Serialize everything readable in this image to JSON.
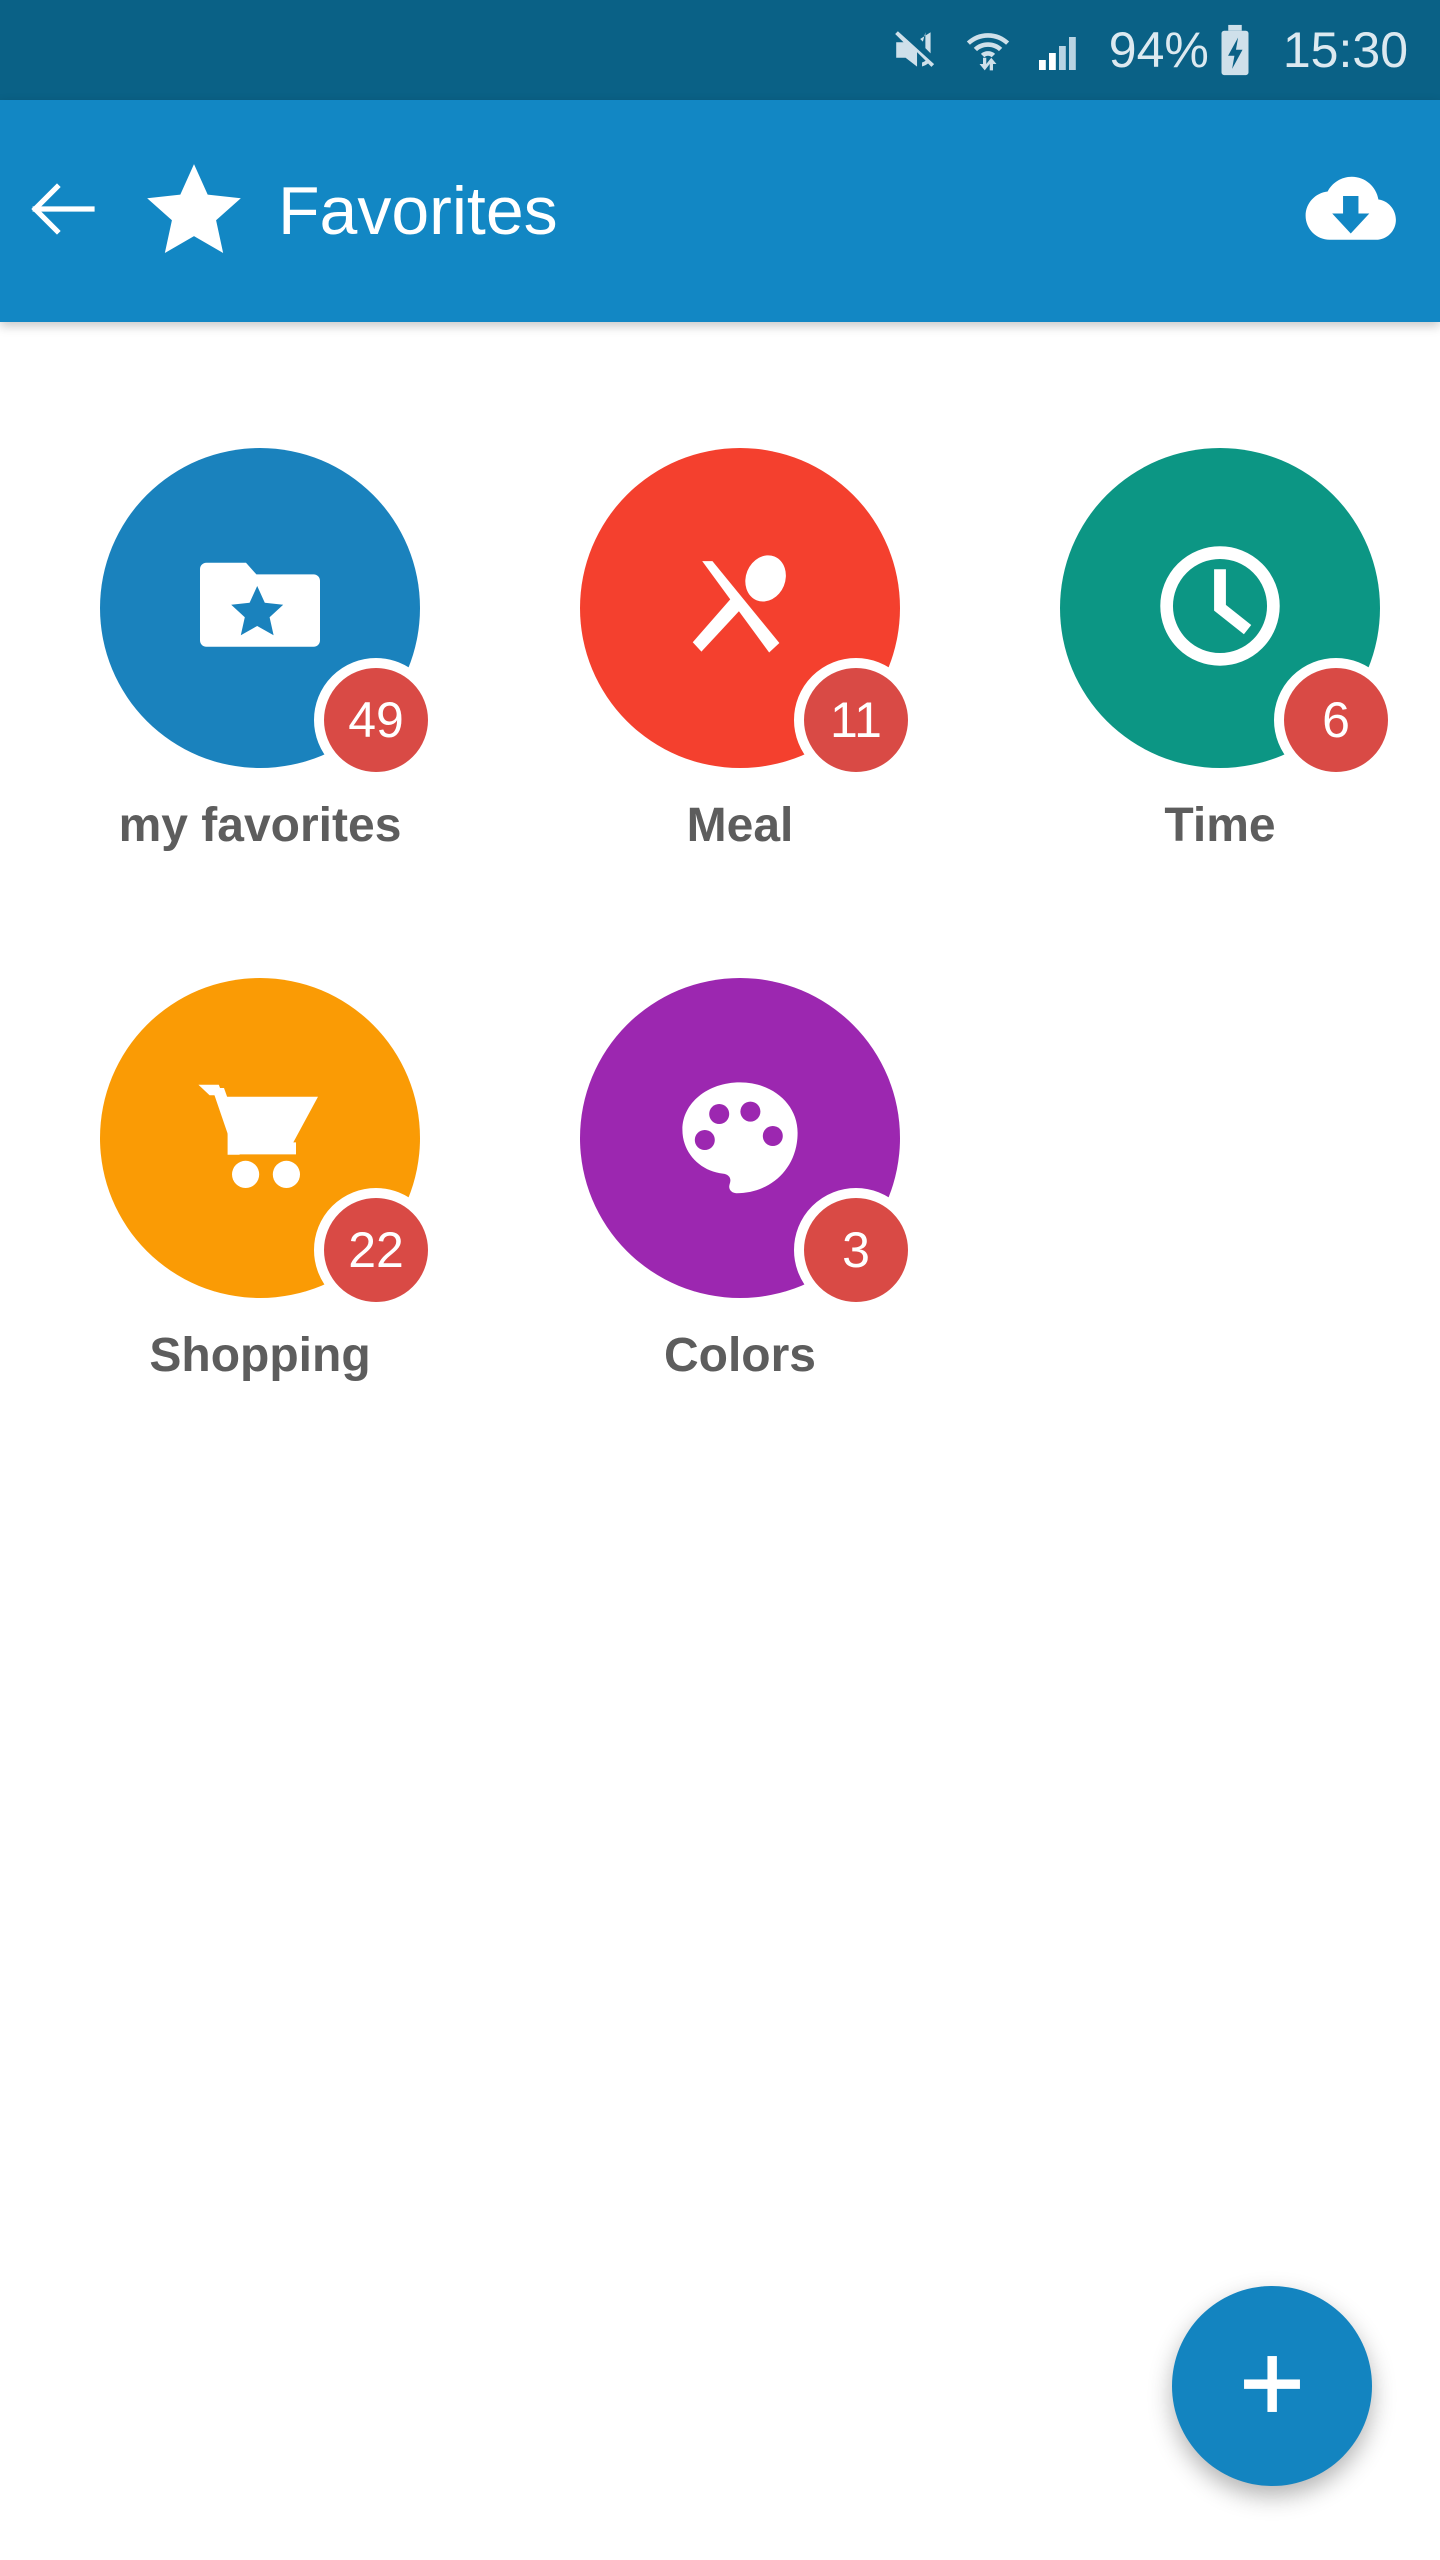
{
  "status_bar": {
    "mute_icon": "mute-icon",
    "wifi_icon": "wifi-transfer-icon",
    "signal_icon": "cellular-signal-icon",
    "battery_percent": "94%",
    "battery_icon": "battery-charging-icon",
    "clock": "15:30",
    "background_color": "#0a6186",
    "text_color": "#dce9f0"
  },
  "app_bar": {
    "back_icon": "back-arrow-icon",
    "star_icon": "star-icon",
    "title": "Favorites",
    "action_icon": "cloud-download-icon",
    "background_color": "#1287c4",
    "text_color": "#ffffff"
  },
  "categories": [
    {
      "label": "my favorites",
      "count": "49",
      "color": "#1a82bd",
      "icon": "folder-star-icon"
    },
    {
      "label": "Meal",
      "count": "11",
      "color": "#f4402e",
      "icon": "utensils-icon"
    },
    {
      "label": "Time",
      "count": "6",
      "color": "#0c9684",
      "icon": "clock-icon"
    },
    {
      "label": "Shopping",
      "count": "22",
      "color": "#fa9b05",
      "icon": "shopping-cart-icon"
    },
    {
      "label": "Colors",
      "count": "3",
      "color": "#9c27b0",
      "icon": "paint-palette-icon"
    }
  ],
  "badge": {
    "background_color": "#d94a45",
    "text_color": "#ffffff"
  },
  "fab": {
    "icon": "plus-icon",
    "label": "+",
    "color": "#1384c0"
  },
  "label_color": "#5d5d5d",
  "page_background": "#ffffff"
}
